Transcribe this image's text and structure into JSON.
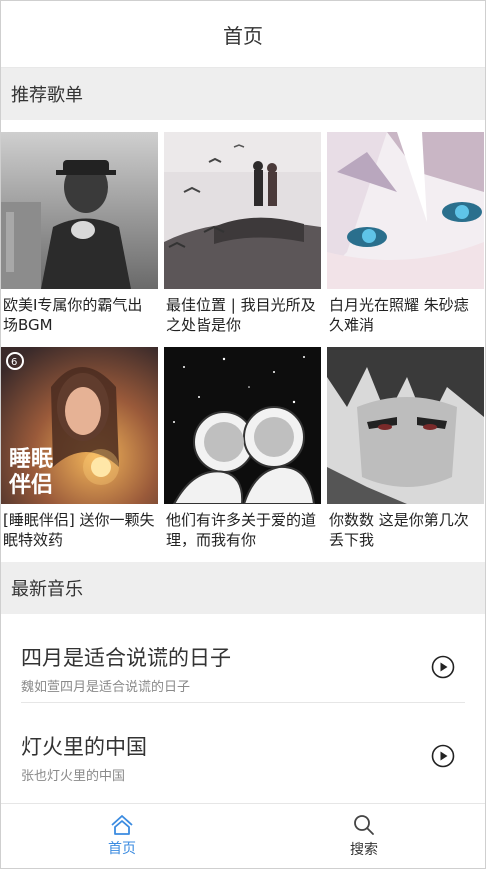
{
  "header": {
    "title": "首页"
  },
  "recommend": {
    "section_title": "推荐歌单",
    "playlists": [
      {
        "title": "欧美I专属你的霸气出场BGM"
      },
      {
        "title": "最佳位置 | 我目光所及之处皆是你"
      },
      {
        "title": "白月光在照耀 朱砂痣久难消"
      },
      {
        "title": "[睡眠伴侣] 送你一颗失眠特效药",
        "cover_text": "睡眠\n伴侣"
      },
      {
        "title": "他们有许多关于爱的道理，而我有你"
      },
      {
        "title": "你数数 这是你第几次丢下我"
      }
    ]
  },
  "latest": {
    "section_title": "最新音乐",
    "songs": [
      {
        "name": "四月是适合说谎的日子",
        "sub": "魏如萱四月是适合说谎的日子"
      },
      {
        "name": "灯火里的中国",
        "sub": "张也灯火里的中国"
      }
    ]
  },
  "tabbar": {
    "tabs": [
      {
        "label": "首页",
        "icon": "home-icon",
        "active": true
      },
      {
        "label": "搜索",
        "icon": "search-icon",
        "active": false
      }
    ]
  },
  "colors": {
    "accent": "#3b8be0",
    "section_bg": "#eeeeee"
  }
}
